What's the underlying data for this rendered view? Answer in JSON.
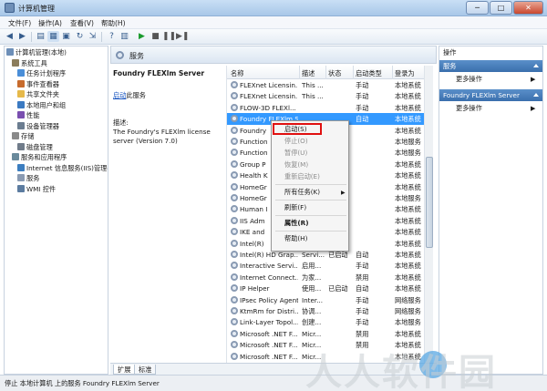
{
  "window": {
    "title": "计算机管理",
    "min": "─",
    "max": "□",
    "close": "✕"
  },
  "menubar": [
    "文件(F)",
    "操作(A)",
    "查看(V)",
    "帮助(H)"
  ],
  "tree": [
    {
      "label": "计算机管理(本地)",
      "icon": "computer-icon",
      "indent": 0
    },
    {
      "label": "系统工具",
      "icon": "tools-icon",
      "indent": 1
    },
    {
      "label": "任务计划程序",
      "icon": "clock-icon",
      "indent": 2
    },
    {
      "label": "事件查看器",
      "icon": "event-log-icon",
      "indent": 2
    },
    {
      "label": "共享文件夹",
      "icon": "shared-folder-icon",
      "indent": 2
    },
    {
      "label": "本地用户和组",
      "icon": "users-icon",
      "indent": 2
    },
    {
      "label": "性能",
      "icon": "performance-icon",
      "indent": 2
    },
    {
      "label": "设备管理器",
      "icon": "device-manager-icon",
      "indent": 2
    },
    {
      "label": "存储",
      "icon": "storage-icon",
      "indent": 1
    },
    {
      "label": "磁盘管理",
      "icon": "disk-icon",
      "indent": 2
    },
    {
      "label": "服务和应用程序",
      "icon": "services-apps-icon",
      "indent": 1
    },
    {
      "label": "Internet 信息服务(IIS)管理器",
      "icon": "iis-icon",
      "indent": 2
    },
    {
      "label": "服务",
      "icon": "gear-icon",
      "indent": 2
    },
    {
      "label": "WMI 控件",
      "icon": "wmi-icon",
      "indent": 2
    }
  ],
  "center": {
    "header_title": "服务",
    "service_name": "Foundry FLEXlm Server",
    "start_link": "启动",
    "start_suffix": "此服务",
    "desc_label": "描述:",
    "desc_text": "The Foundry's FLEXlm license server (Version 7.0)"
  },
  "columns": [
    "名称",
    "描述",
    "状态",
    "启动类型",
    "登录为"
  ],
  "rows": [
    {
      "name": "FLEXnet Licensin...",
      "desc": "This ...",
      "status": "",
      "startup": "手动",
      "logon": "本地系统"
    },
    {
      "name": "FLEXnet Licensin...",
      "desc": "This ...",
      "status": "",
      "startup": "手动",
      "logon": "本地系统"
    },
    {
      "name": "FLOW-3D FLEXl...",
      "desc": "",
      "status": "",
      "startup": "手动",
      "logon": "本地系统"
    },
    {
      "name": "Foundry FLEXlm Server",
      "desc": "",
      "status": "",
      "startup": "自动",
      "logon": "本地系统",
      "selected": true
    },
    {
      "name": "Foundry",
      "desc": "",
      "status": "",
      "startup": "",
      "logon": "本地系统"
    },
    {
      "name": "Function",
      "desc": "",
      "status": "",
      "startup": "",
      "logon": "本地服务"
    },
    {
      "name": "Function",
      "desc": "",
      "status": "",
      "startup": "",
      "logon": "本地服务"
    },
    {
      "name": "Group P",
      "desc": "",
      "status": "",
      "startup": "",
      "logon": "本地系统"
    },
    {
      "name": "Health K",
      "desc": "",
      "status": "",
      "startup": "",
      "logon": "本地系统"
    },
    {
      "name": "HomeGr",
      "desc": "",
      "status": "",
      "startup": "",
      "logon": "本地系统"
    },
    {
      "name": "HomeGr",
      "desc": "",
      "status": "",
      "startup": "",
      "logon": "本地服务"
    },
    {
      "name": "Human I",
      "desc": "",
      "status": "",
      "startup": "",
      "logon": "本地系统"
    },
    {
      "name": "IIS Adm",
      "desc": "",
      "status": "",
      "startup": "",
      "logon": "本地系统"
    },
    {
      "name": "IKE and",
      "desc": "",
      "status": "",
      "startup": "",
      "logon": "本地系统"
    },
    {
      "name": "Intel(R)",
      "desc": "",
      "status": "",
      "startup": "",
      "logon": "本地系统"
    },
    {
      "name": "Intel(R) HD Grap...",
      "desc": "Servi...",
      "status": "已启动",
      "startup": "自动",
      "logon": "本地系统"
    },
    {
      "name": "Interactive Servi...",
      "desc": "启用...",
      "status": "",
      "startup": "手动",
      "logon": "本地系统"
    },
    {
      "name": "Internet Connect...",
      "desc": "为家...",
      "status": "",
      "startup": "禁用",
      "logon": "本地系统"
    },
    {
      "name": "IP Helper",
      "desc": "使用...",
      "status": "已启动",
      "startup": "自动",
      "logon": "本地系统"
    },
    {
      "name": "IPsec Policy Agent",
      "desc": "Inter...",
      "status": "",
      "startup": "手动",
      "logon": "网络服务"
    },
    {
      "name": "KtmRm for Distri...",
      "desc": "协调...",
      "status": "",
      "startup": "手动",
      "logon": "网络服务"
    },
    {
      "name": "Link-Layer Topol...",
      "desc": "创建...",
      "status": "",
      "startup": "手动",
      "logon": "本地服务"
    },
    {
      "name": "Microsoft .NET F...",
      "desc": "Micr...",
      "status": "",
      "startup": "禁用",
      "logon": "本地系统"
    },
    {
      "name": "Microsoft .NET F...",
      "desc": "Micr...",
      "status": "",
      "startup": "禁用",
      "logon": "本地系统"
    },
    {
      "name": "Microsoft .NET F...",
      "desc": "Micr...",
      "status": "",
      "startup": "",
      "logon": "本地系统"
    },
    {
      "name": "Microsoft .NET F...",
      "desc": "Micr...",
      "status": "",
      "startup": "",
      "logon": "本地系统"
    }
  ],
  "context_menu": [
    {
      "label": "启动(S)",
      "enabled": true,
      "highlight": true
    },
    {
      "label": "停止(O)",
      "enabled": false
    },
    {
      "label": "暂停(U)",
      "enabled": false
    },
    {
      "label": "恢复(M)",
      "enabled": false
    },
    {
      "label": "重新启动(E)",
      "enabled": false
    },
    {
      "sep": true
    },
    {
      "label": "所有任务(K)",
      "enabled": true,
      "submenu": true
    },
    {
      "sep": true
    },
    {
      "label": "刷新(F)",
      "enabled": true
    },
    {
      "sep": true
    },
    {
      "label": "属性(R)",
      "enabled": true,
      "bold": true
    },
    {
      "sep": true
    },
    {
      "label": "帮助(H)",
      "enabled": true
    }
  ],
  "tabs": [
    "扩展",
    "标准"
  ],
  "actions": {
    "title": "操作",
    "group1": "服务",
    "more1": "更多操作",
    "group2": "Foundry FLEXlm Server",
    "more2": "更多操作"
  },
  "statusbar": {
    "text": "停止 本地计算机 上的服务 Foundry FLEXlm Server"
  },
  "watermark": "人人软件园",
  "colors": {
    "accent": "#3399ff",
    "group_header": "#3a6fad",
    "highlight_box": "#e01010"
  }
}
